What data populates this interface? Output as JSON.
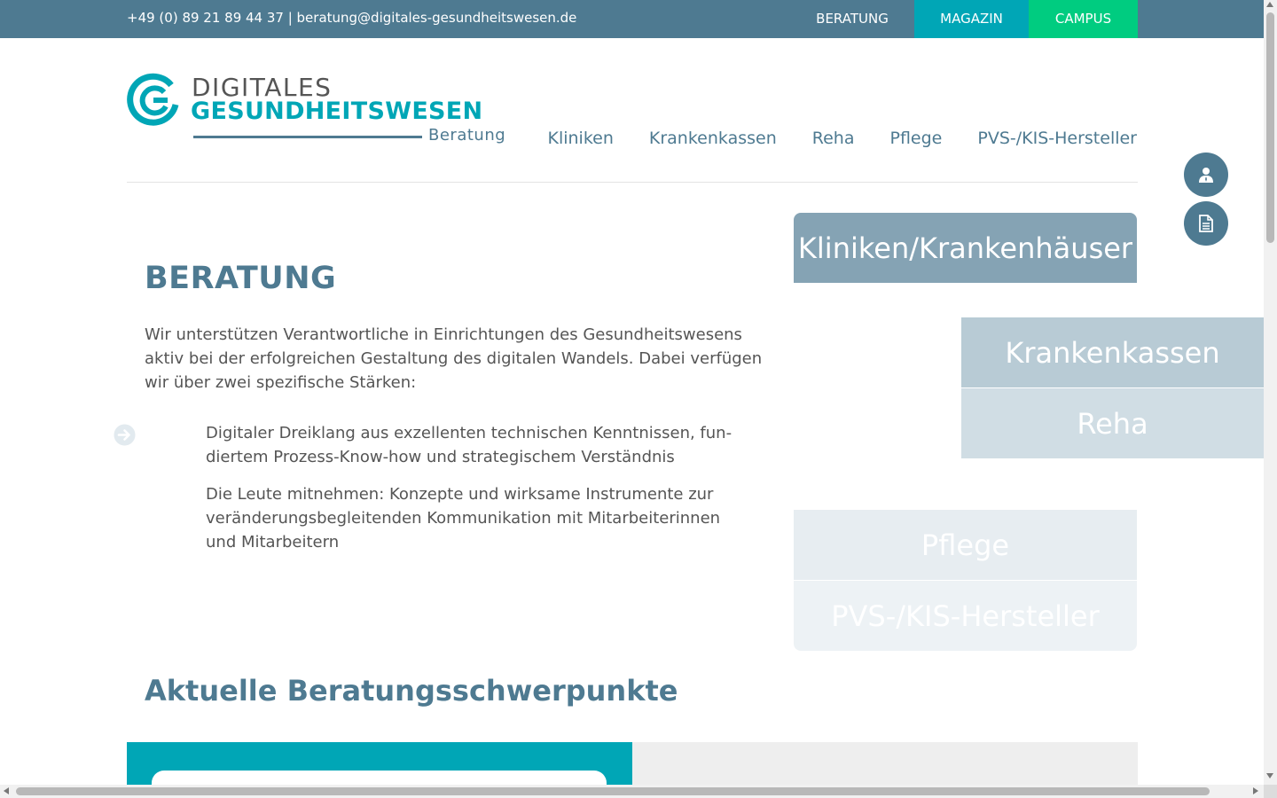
{
  "topbar": {
    "contact": "+49 (0) 89 21 89 44 37 | beratung@digitales-gesundheitswesen.de",
    "links": [
      {
        "label": "BERATUNG"
      },
      {
        "label": "MAGAZIN",
        "color": "#00a6b6"
      },
      {
        "label": "CAMPUS",
        "color": "#00cc80"
      }
    ],
    "background": "#4e7a91"
  },
  "logo": {
    "line1": "DIGITALES",
    "line2": "GESUNDHEITSWESEN",
    "line3": "Beratung"
  },
  "nav": {
    "items": [
      "Kliniken",
      "Krankenkassen",
      "Reha",
      "Pflege",
      "PVS-/KIS-Hersteller"
    ]
  },
  "floating_buttons": [
    {
      "icon": "user-icon"
    },
    {
      "icon": "document-icon"
    }
  ],
  "intro": {
    "heading": "BERATUNG",
    "paragraph": "Wir unterstützen Verantwortliche in Einrichtungen des Gesundheitswesens aktiv bei der erfolgreichen Gestaltung des digitalen Wandels. Dabei verfügen wir über zwei spezifische Stärken:",
    "bullets": [
      "Digitaler Dreiklang aus exzellenten technischen Kenntnissen, fun­diertem Prozess-Know-how und strategischem Verständnis",
      "Die Leute mitnehmen: Konzepte und wirksame Instrumente zur ver­änderungsbegleitenden Kommunikation mit Mitarbeiterinnen und Mitarbeitern"
    ],
    "bullet_icon": "arrow-circle-right-icon"
  },
  "tiles": [
    {
      "label": "Kliniken/Krankenhäuser"
    },
    {
      "label": "Krankenkassen"
    },
    {
      "label": "Reha"
    },
    {
      "label": "Pflege"
    },
    {
      "label": "PVS-/KIS-Hersteller"
    }
  ],
  "schwerpunkte": {
    "heading": "Aktuelle Beratungsschwerpunkte"
  },
  "colors": {
    "primary": "#4e7a91",
    "teal": "#00a6b6",
    "green": "#00cc80"
  }
}
